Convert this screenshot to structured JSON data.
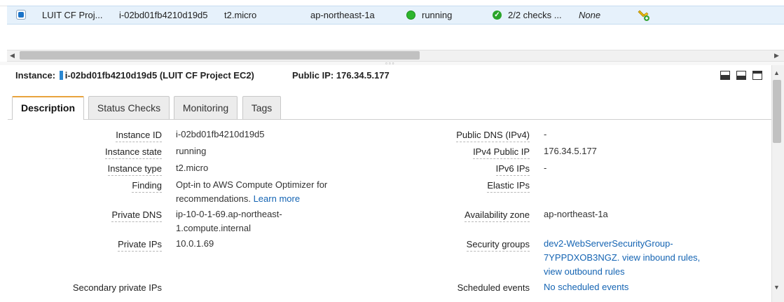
{
  "instance_row": {
    "name": "LUIT CF Proj...",
    "instance_id": "i-02bd01fb4210d19d5",
    "instance_type": "t2.micro",
    "availability_zone": "ap-northeast-1a",
    "state": "running",
    "status_checks": "2/2 checks ...",
    "alarm_status": "None",
    "colors": {
      "selected_bg": "#e6f1fb",
      "running": "#2db52d"
    }
  },
  "header": {
    "instance_label": "Instance:",
    "instance_value": "i-02bd01fb4210d19d5 (LUIT CF Project EC2)",
    "public_ip_label": "Public IP:",
    "public_ip_value": "176.34.5.177"
  },
  "tabs": [
    {
      "label": "Description",
      "active": true
    },
    {
      "label": "Status Checks",
      "active": false
    },
    {
      "label": "Monitoring",
      "active": false
    },
    {
      "label": "Tags",
      "active": false
    }
  ],
  "details_left": {
    "instance_id": {
      "label": "Instance ID",
      "value": "i-02bd01fb4210d19d5"
    },
    "instance_state": {
      "label": "Instance state",
      "value": "running"
    },
    "instance_type": {
      "label": "Instance type",
      "value": "t2.micro"
    },
    "finding": {
      "label": "Finding",
      "value": "Opt-in to AWS Compute Optimizer for recommendations.",
      "link": "Learn more"
    },
    "private_dns": {
      "label": "Private DNS",
      "value": "ip-10-0-1-69.ap-northeast-1.compute.internal"
    },
    "private_ips": {
      "label": "Private IPs",
      "value": "10.0.1.69"
    },
    "secondary_private_ips": {
      "label": "Secondary private IPs",
      "value": ""
    }
  },
  "details_right": {
    "public_dns": {
      "label": "Public DNS (IPv4)",
      "value": "-"
    },
    "ipv4_public_ip": {
      "label": "IPv4 Public IP",
      "value": "176.34.5.177"
    },
    "ipv6_ips": {
      "label": "IPv6 IPs",
      "value": "-"
    },
    "elastic_ips": {
      "label": "Elastic IPs",
      "value": ""
    },
    "availability_zone": {
      "label": "Availability zone",
      "value": "ap-northeast-1a"
    },
    "security_groups": {
      "label": "Security groups",
      "group_link": "dev2-WebServerSecurityGroup-7YPPDXOB3NGZ.",
      "inbound_link": "view inbound rules,",
      "outbound_link": "view outbound rules"
    },
    "scheduled_events": {
      "label": "Scheduled events",
      "value": "No scheduled events"
    }
  },
  "icons": {
    "checkbox": "checkbox-checked-icon",
    "state": "green-dot-icon",
    "status": "check-circle-icon",
    "alarm": "alarm-bell-icon",
    "layout": [
      "layout-bottom-icon",
      "layout-split-icon",
      "layout-top-icon"
    ]
  }
}
